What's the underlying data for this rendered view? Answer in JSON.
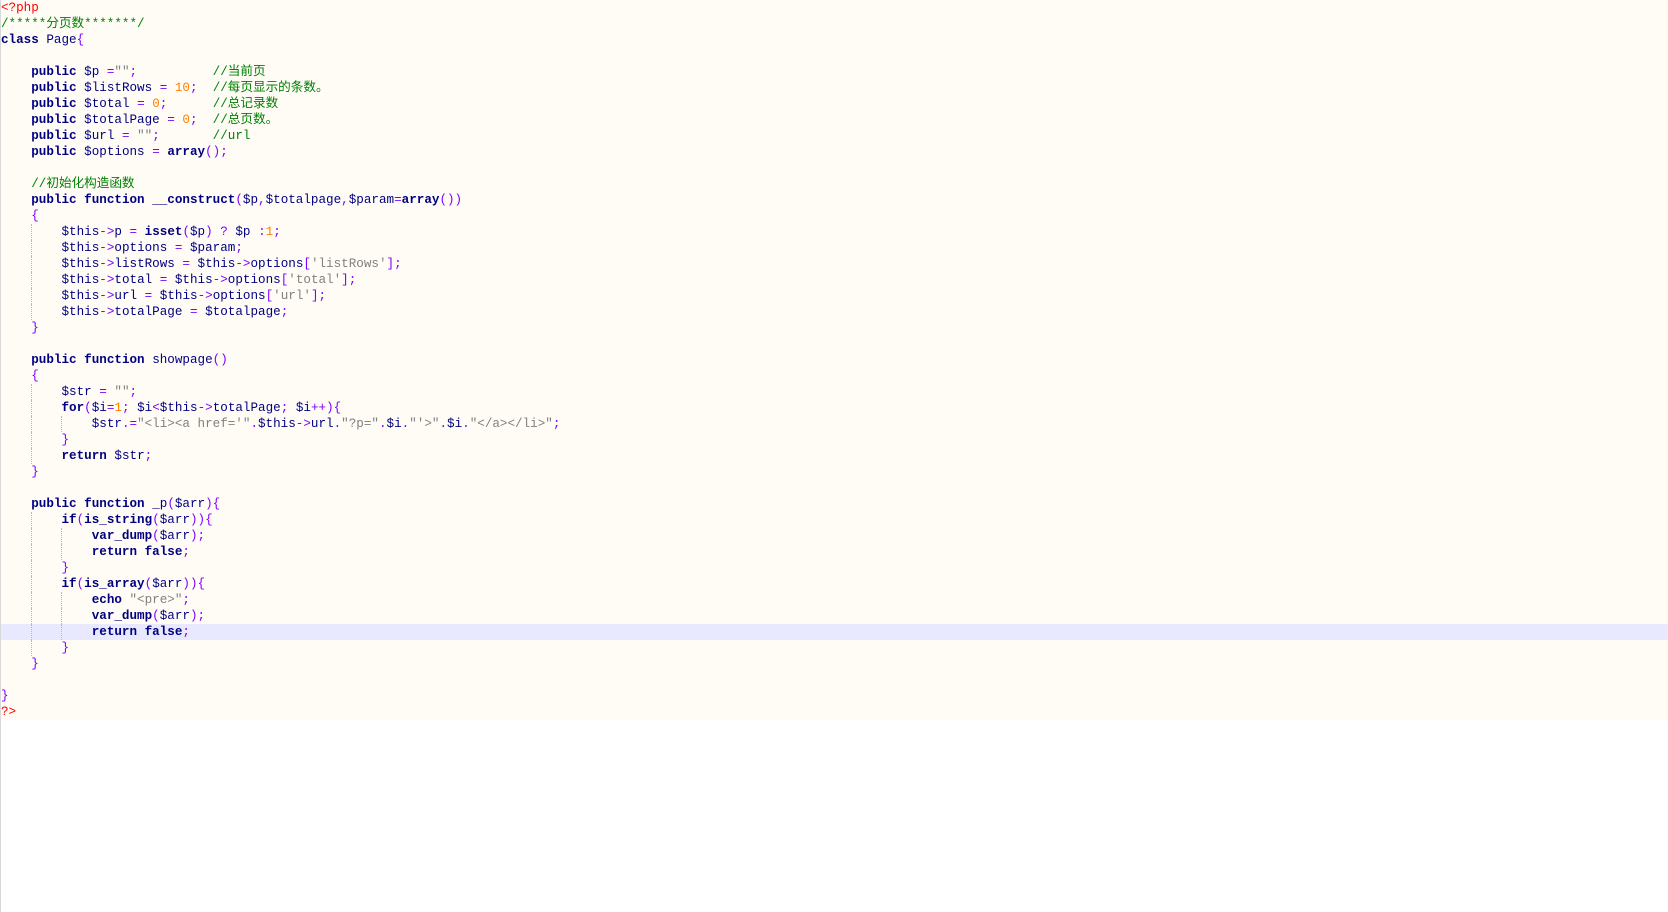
{
  "editor": {
    "current_line": 39,
    "lines": [
      {
        "indent": 0,
        "tokens": [
          [
            "php",
            "<?php"
          ]
        ]
      },
      {
        "indent": 0,
        "tokens": [
          [
            "cmt",
            "/*****分页数*******/"
          ]
        ]
      },
      {
        "indent": 0,
        "tokens": [
          [
            "kw",
            "class"
          ],
          [
            "txt",
            " Page"
          ],
          [
            "op",
            "{"
          ]
        ]
      },
      {
        "indent": 0,
        "tokens": []
      },
      {
        "indent": 1,
        "tokens": [
          [
            "kw",
            "public"
          ],
          [
            "txt",
            " "
          ],
          [
            "var",
            "$p"
          ],
          [
            "txt",
            " "
          ],
          [
            "op",
            "="
          ],
          [
            "str",
            "\"\""
          ],
          [
            "op",
            ";"
          ],
          [
            "txt",
            "          "
          ],
          [
            "cmt",
            "//当前页"
          ]
        ]
      },
      {
        "indent": 1,
        "tokens": [
          [
            "kw",
            "public"
          ],
          [
            "txt",
            " "
          ],
          [
            "var",
            "$listRows"
          ],
          [
            "txt",
            " "
          ],
          [
            "op",
            "="
          ],
          [
            "txt",
            " "
          ],
          [
            "num",
            "10"
          ],
          [
            "op",
            ";"
          ],
          [
            "txt",
            "  "
          ],
          [
            "cmt",
            "//每页显示的条数。"
          ]
        ]
      },
      {
        "indent": 1,
        "tokens": [
          [
            "kw",
            "public"
          ],
          [
            "txt",
            " "
          ],
          [
            "var",
            "$total"
          ],
          [
            "txt",
            " "
          ],
          [
            "op",
            "="
          ],
          [
            "txt",
            " "
          ],
          [
            "num",
            "0"
          ],
          [
            "op",
            ";"
          ],
          [
            "txt",
            "      "
          ],
          [
            "cmt",
            "//总记录数"
          ]
        ]
      },
      {
        "indent": 1,
        "tokens": [
          [
            "kw",
            "public"
          ],
          [
            "txt",
            " "
          ],
          [
            "var",
            "$totalPage"
          ],
          [
            "txt",
            " "
          ],
          [
            "op",
            "="
          ],
          [
            "txt",
            " "
          ],
          [
            "num",
            "0"
          ],
          [
            "op",
            ";"
          ],
          [
            "txt",
            "  "
          ],
          [
            "cmt",
            "//总页数。"
          ]
        ]
      },
      {
        "indent": 1,
        "tokens": [
          [
            "kw",
            "public"
          ],
          [
            "txt",
            " "
          ],
          [
            "var",
            "$url"
          ],
          [
            "txt",
            " "
          ],
          [
            "op",
            "="
          ],
          [
            "txt",
            " "
          ],
          [
            "str",
            "\"\""
          ],
          [
            "op",
            ";"
          ],
          [
            "txt",
            "       "
          ],
          [
            "cmt",
            "//url"
          ]
        ]
      },
      {
        "indent": 1,
        "tokens": [
          [
            "kw",
            "public"
          ],
          [
            "txt",
            " "
          ],
          [
            "var",
            "$options"
          ],
          [
            "txt",
            " "
          ],
          [
            "op",
            "="
          ],
          [
            "txt",
            " "
          ],
          [
            "kw",
            "array"
          ],
          [
            "op",
            "();"
          ]
        ]
      },
      {
        "indent": 0,
        "tokens": []
      },
      {
        "indent": 1,
        "tokens": [
          [
            "cmt",
            "//初始化构造函数"
          ]
        ]
      },
      {
        "indent": 1,
        "tokens": [
          [
            "kw",
            "public"
          ],
          [
            "txt",
            " "
          ],
          [
            "kw",
            "function"
          ],
          [
            "txt",
            " "
          ],
          [
            "kw",
            "__construct"
          ],
          [
            "op",
            "("
          ],
          [
            "var",
            "$p"
          ],
          [
            "op",
            ","
          ],
          [
            "var",
            "$totalpage"
          ],
          [
            "op",
            ","
          ],
          [
            "var",
            "$param"
          ],
          [
            "op",
            "="
          ],
          [
            "kw",
            "array"
          ],
          [
            "op",
            "())"
          ]
        ]
      },
      {
        "indent": 1,
        "tokens": [
          [
            "op",
            "{"
          ]
        ]
      },
      {
        "indent": 2,
        "tokens": [
          [
            "var",
            "$this"
          ],
          [
            "op",
            "->"
          ],
          [
            "txt",
            "p"
          ],
          [
            "txt",
            " "
          ],
          [
            "op",
            "="
          ],
          [
            "txt",
            " "
          ],
          [
            "kw",
            "isset"
          ],
          [
            "op",
            "("
          ],
          [
            "var",
            "$p"
          ],
          [
            "op",
            ")"
          ],
          [
            "txt",
            " "
          ],
          [
            "op",
            "?"
          ],
          [
            "txt",
            " "
          ],
          [
            "var",
            "$p"
          ],
          [
            "txt",
            " "
          ],
          [
            "op",
            ":"
          ],
          [
            "num",
            "1"
          ],
          [
            "op",
            ";"
          ]
        ]
      },
      {
        "indent": 2,
        "tokens": [
          [
            "var",
            "$this"
          ],
          [
            "op",
            "->"
          ],
          [
            "txt",
            "options"
          ],
          [
            "txt",
            " "
          ],
          [
            "op",
            "="
          ],
          [
            "txt",
            " "
          ],
          [
            "var",
            "$param"
          ],
          [
            "op",
            ";"
          ]
        ]
      },
      {
        "indent": 2,
        "tokens": [
          [
            "var",
            "$this"
          ],
          [
            "op",
            "->"
          ],
          [
            "txt",
            "listRows"
          ],
          [
            "txt",
            " "
          ],
          [
            "op",
            "="
          ],
          [
            "txt",
            " "
          ],
          [
            "var",
            "$this"
          ],
          [
            "op",
            "->"
          ],
          [
            "txt",
            "options"
          ],
          [
            "op",
            "["
          ],
          [
            "str",
            "'listRows'"
          ],
          [
            "op",
            "];"
          ]
        ]
      },
      {
        "indent": 2,
        "tokens": [
          [
            "var",
            "$this"
          ],
          [
            "op",
            "->"
          ],
          [
            "txt",
            "total"
          ],
          [
            "txt",
            " "
          ],
          [
            "op",
            "="
          ],
          [
            "txt",
            " "
          ],
          [
            "var",
            "$this"
          ],
          [
            "op",
            "->"
          ],
          [
            "txt",
            "options"
          ],
          [
            "op",
            "["
          ],
          [
            "str",
            "'total'"
          ],
          [
            "op",
            "];"
          ]
        ]
      },
      {
        "indent": 2,
        "tokens": [
          [
            "var",
            "$this"
          ],
          [
            "op",
            "->"
          ],
          [
            "txt",
            "url"
          ],
          [
            "txt",
            " "
          ],
          [
            "op",
            "="
          ],
          [
            "txt",
            " "
          ],
          [
            "var",
            "$this"
          ],
          [
            "op",
            "->"
          ],
          [
            "txt",
            "options"
          ],
          [
            "op",
            "["
          ],
          [
            "str",
            "'url'"
          ],
          [
            "op",
            "];"
          ]
        ]
      },
      {
        "indent": 2,
        "tokens": [
          [
            "var",
            "$this"
          ],
          [
            "op",
            "->"
          ],
          [
            "txt",
            "totalPage"
          ],
          [
            "txt",
            " "
          ],
          [
            "op",
            "="
          ],
          [
            "txt",
            " "
          ],
          [
            "var",
            "$totalpage"
          ],
          [
            "op",
            ";"
          ]
        ]
      },
      {
        "indent": 1,
        "tokens": [
          [
            "op",
            "}"
          ]
        ]
      },
      {
        "indent": 0,
        "tokens": []
      },
      {
        "indent": 1,
        "tokens": [
          [
            "kw",
            "public"
          ],
          [
            "txt",
            " "
          ],
          [
            "kw",
            "function"
          ],
          [
            "txt",
            " "
          ],
          [
            "txt",
            "showpage"
          ],
          [
            "op",
            "()"
          ]
        ]
      },
      {
        "indent": 1,
        "tokens": [
          [
            "op",
            "{"
          ]
        ]
      },
      {
        "indent": 2,
        "tokens": [
          [
            "var",
            "$str"
          ],
          [
            "txt",
            " "
          ],
          [
            "op",
            "="
          ],
          [
            "txt",
            " "
          ],
          [
            "str",
            "\"\""
          ],
          [
            "op",
            ";"
          ]
        ]
      },
      {
        "indent": 2,
        "tokens": [
          [
            "kw",
            "for"
          ],
          [
            "op",
            "("
          ],
          [
            "var",
            "$i"
          ],
          [
            "op",
            "="
          ],
          [
            "num",
            "1"
          ],
          [
            "op",
            ";"
          ],
          [
            "txt",
            " "
          ],
          [
            "var",
            "$i"
          ],
          [
            "op",
            "<"
          ],
          [
            "var",
            "$this"
          ],
          [
            "op",
            "->"
          ],
          [
            "txt",
            "totalPage"
          ],
          [
            "op",
            ";"
          ],
          [
            "txt",
            " "
          ],
          [
            "var",
            "$i"
          ],
          [
            "op",
            "++){"
          ]
        ]
      },
      {
        "indent": 3,
        "tokens": [
          [
            "var",
            "$str"
          ],
          [
            "op",
            ".="
          ],
          [
            "str",
            "\"<li><a href='\""
          ],
          [
            "op",
            "."
          ],
          [
            "var",
            "$this"
          ],
          [
            "op",
            "->"
          ],
          [
            "txt",
            "url"
          ],
          [
            "op",
            "."
          ],
          [
            "str",
            "\"?p=\""
          ],
          [
            "op",
            "."
          ],
          [
            "var",
            "$i"
          ],
          [
            "op",
            "."
          ],
          [
            "str",
            "\"'>\""
          ],
          [
            "op",
            "."
          ],
          [
            "var",
            "$i"
          ],
          [
            "op",
            "."
          ],
          [
            "str",
            "\"</a></li>\""
          ],
          [
            "op",
            ";"
          ]
        ]
      },
      {
        "indent": 2,
        "tokens": [
          [
            "op",
            "}"
          ]
        ]
      },
      {
        "indent": 2,
        "tokens": [
          [
            "kw",
            "return"
          ],
          [
            "txt",
            " "
          ],
          [
            "var",
            "$str"
          ],
          [
            "op",
            ";"
          ]
        ]
      },
      {
        "indent": 1,
        "tokens": [
          [
            "op",
            "}"
          ]
        ]
      },
      {
        "indent": 0,
        "tokens": []
      },
      {
        "indent": 1,
        "tokens": [
          [
            "kw",
            "public"
          ],
          [
            "txt",
            " "
          ],
          [
            "kw",
            "function"
          ],
          [
            "txt",
            " "
          ],
          [
            "txt",
            "_p"
          ],
          [
            "op",
            "("
          ],
          [
            "var",
            "$arr"
          ],
          [
            "op",
            "){"
          ]
        ]
      },
      {
        "indent": 2,
        "tokens": [
          [
            "kw",
            "if"
          ],
          [
            "op",
            "("
          ],
          [
            "kw",
            "is_string"
          ],
          [
            "op",
            "("
          ],
          [
            "var",
            "$arr"
          ],
          [
            "op",
            ")){"
          ]
        ]
      },
      {
        "indent": 3,
        "tokens": [
          [
            "kw",
            "var_dump"
          ],
          [
            "op",
            "("
          ],
          [
            "var",
            "$arr"
          ],
          [
            "op",
            ");"
          ]
        ]
      },
      {
        "indent": 3,
        "tokens": [
          [
            "kw",
            "return"
          ],
          [
            "txt",
            " "
          ],
          [
            "kw",
            "false"
          ],
          [
            "op",
            ";"
          ]
        ]
      },
      {
        "indent": 2,
        "tokens": [
          [
            "op",
            "}"
          ]
        ]
      },
      {
        "indent": 2,
        "tokens": [
          [
            "kw",
            "if"
          ],
          [
            "op",
            "("
          ],
          [
            "kw",
            "is_array"
          ],
          [
            "op",
            "("
          ],
          [
            "var",
            "$arr"
          ],
          [
            "op",
            ")){"
          ]
        ]
      },
      {
        "indent": 3,
        "tokens": [
          [
            "kw",
            "echo"
          ],
          [
            "txt",
            " "
          ],
          [
            "str",
            "\"<pre>\""
          ],
          [
            "op",
            ";"
          ]
        ]
      },
      {
        "indent": 3,
        "tokens": [
          [
            "kw",
            "var_dump"
          ],
          [
            "op",
            "("
          ],
          [
            "var",
            "$arr"
          ],
          [
            "op",
            ");"
          ]
        ]
      },
      {
        "indent": 3,
        "tokens": [
          [
            "kw",
            "return"
          ],
          [
            "txt",
            " "
          ],
          [
            "kw",
            "false"
          ],
          [
            "op",
            ";"
          ]
        ]
      },
      {
        "indent": 2,
        "tokens": [
          [
            "op",
            "}"
          ]
        ]
      },
      {
        "indent": 1,
        "tokens": [
          [
            "op",
            "}"
          ]
        ]
      },
      {
        "indent": 0,
        "tokens": []
      },
      {
        "indent": 0,
        "tokens": [
          [
            "op",
            "}"
          ]
        ]
      },
      {
        "indent": 0,
        "tokens": [
          [
            "php",
            "?>"
          ]
        ]
      }
    ]
  }
}
